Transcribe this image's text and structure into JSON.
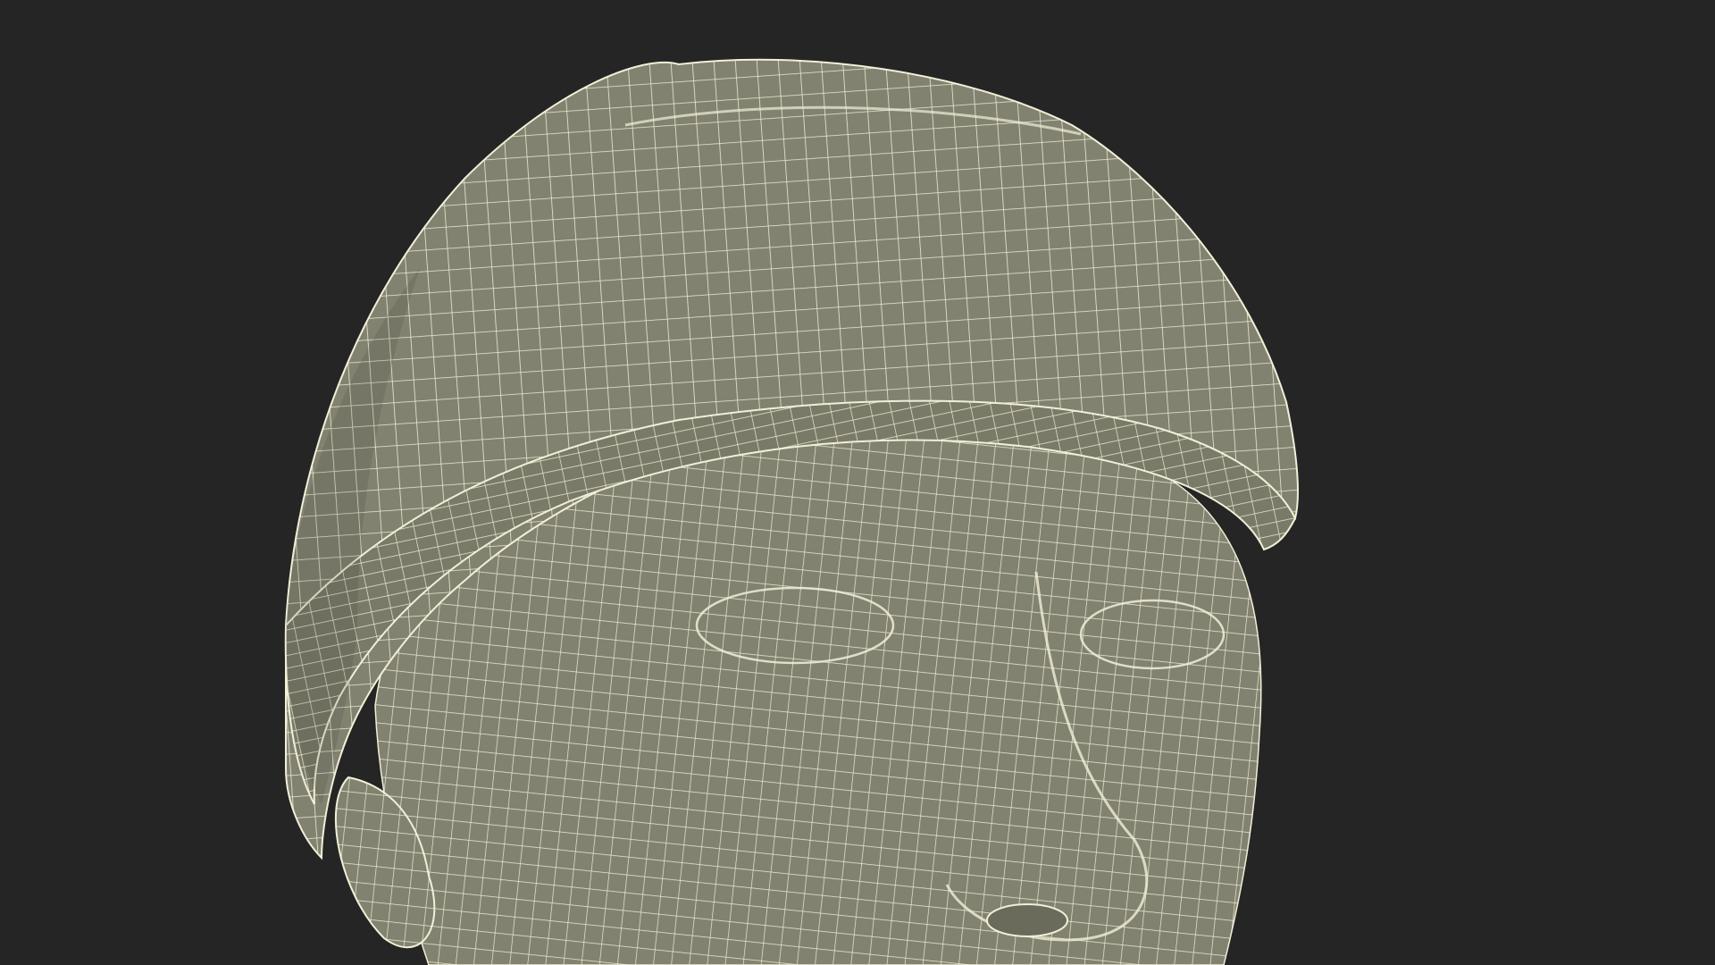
{
  "scene": {
    "subject": "wireframe-head-with-beanie",
    "colors": {
      "background": "#252525",
      "surface": "#828270",
      "surface_shadow": "#6b6b5b",
      "wire": "#f2efd8"
    }
  }
}
